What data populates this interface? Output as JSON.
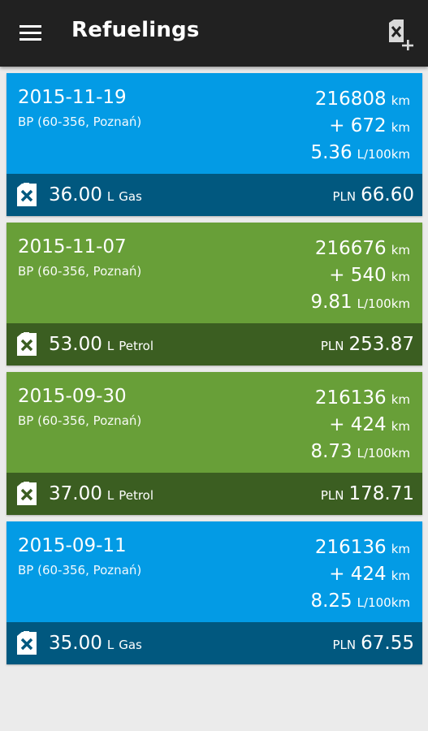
{
  "app": {
    "title": "Refuelings"
  },
  "colors": {
    "appbar": "#212121",
    "gas_top": "#039be5",
    "gas_bottom": "#01587f",
    "petrol_top": "#689f38",
    "petrol_bottom": "#3b5e21",
    "background": "#ebebeb"
  },
  "icons": {
    "menu": "hamburger-menu-icon",
    "add": "add-refueling-icon",
    "fuel": "fuel-can-icon"
  },
  "refuelings": [
    {
      "date": "2015-11-19",
      "station": "BP (60-356, Poznań)",
      "odometer": "216808",
      "odometer_unit": "km",
      "distance": "+ 672",
      "distance_unit": "km",
      "consumption": "5.36",
      "consumption_unit": "L/100km",
      "volume": "36.00",
      "volume_unit": "L",
      "fuel": "Gas",
      "currency": "PLN",
      "cost": "66.60",
      "fuel_type": "gas"
    },
    {
      "date": "2015-11-07",
      "station": "BP (60-356, Poznań)",
      "odometer": "216676",
      "odometer_unit": "km",
      "distance": "+ 540",
      "distance_unit": "km",
      "consumption": "9.81",
      "consumption_unit": "L/100km",
      "volume": "53.00",
      "volume_unit": "L",
      "fuel": "Petrol",
      "currency": "PLN",
      "cost": "253.87",
      "fuel_type": "petrol"
    },
    {
      "date": "2015-09-30",
      "station": "BP (60-356, Poznań)",
      "odometer": "216136",
      "odometer_unit": "km",
      "distance": "+ 424",
      "distance_unit": "km",
      "consumption": "8.73",
      "consumption_unit": "L/100km",
      "volume": "37.00",
      "volume_unit": "L",
      "fuel": "Petrol",
      "currency": "PLN",
      "cost": "178.71",
      "fuel_type": "petrol"
    },
    {
      "date": "2015-09-11",
      "station": "BP (60-356, Poznań)",
      "odometer": "216136",
      "odometer_unit": "km",
      "distance": "+ 424",
      "distance_unit": "km",
      "consumption": "8.25",
      "consumption_unit": "L/100km",
      "volume": "35.00",
      "volume_unit": "L",
      "fuel": "Gas",
      "currency": "PLN",
      "cost": "67.55",
      "fuel_type": "gas"
    }
  ]
}
